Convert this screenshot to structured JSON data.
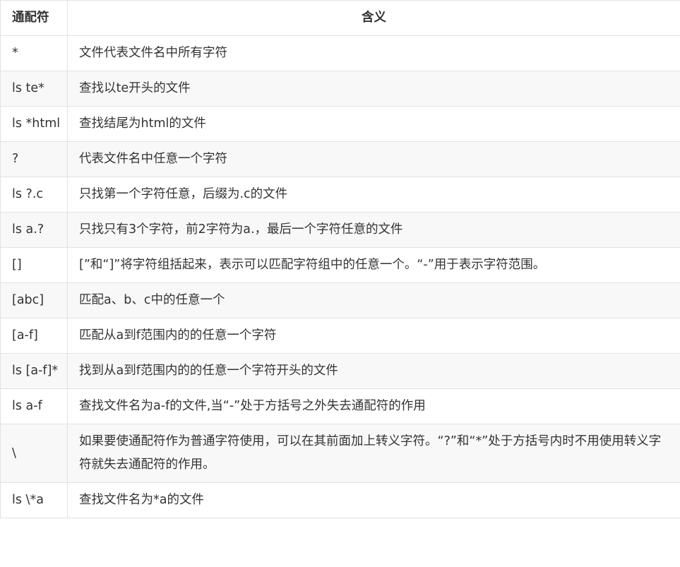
{
  "table": {
    "headers": [
      "通配符",
      "含义"
    ],
    "rows": [
      {
        "pattern": "*",
        "meaning": "文件代表文件名中所有字符"
      },
      {
        "pattern": "ls te*",
        "meaning": "查找以te开头的文件"
      },
      {
        "pattern": "ls *html",
        "meaning": "查找结尾为html的文件"
      },
      {
        "pattern": "?",
        "meaning": "代表文件名中任意一个字符"
      },
      {
        "pattern": "ls ?.c",
        "meaning": "只找第一个字符任意，后缀为.c的文件"
      },
      {
        "pattern": "ls a.?",
        "meaning": "只找只有3个字符，前2字符为a.，最后一个字符任意的文件"
      },
      {
        "pattern": "[]",
        "meaning": "[”和“]”将字符组括起来，表示可以匹配字符组中的任意一个。“-”用于表示字符范围。"
      },
      {
        "pattern": "[abc]",
        "meaning": "匹配a、b、c中的任意一个"
      },
      {
        "pattern": "[a-f]",
        "meaning": "匹配从a到f范围内的的任意一个字符"
      },
      {
        "pattern": "ls [a-f]*",
        "meaning": "找到从a到f范围内的的任意一个字符开头的文件"
      },
      {
        "pattern": "ls a-f",
        "meaning": "查找文件名为a-f的文件,当“-”处于方括号之外失去通配符的作用"
      },
      {
        "pattern": "\\",
        "meaning": "如果要使通配符作为普通字符使用，可以在其前面加上转义字符。“?”和“*”处于方括号内时不用使用转义字符就失去通配符的作用。"
      },
      {
        "pattern": "ls \\*a",
        "meaning": "查找文件名为*a的文件"
      }
    ]
  }
}
